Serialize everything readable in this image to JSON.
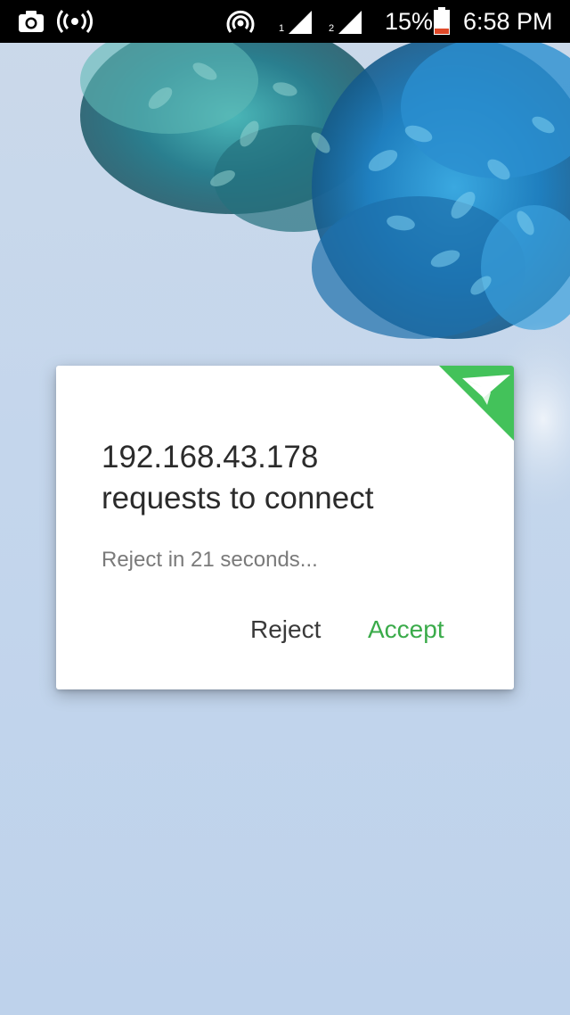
{
  "status_bar": {
    "battery_percent": "15%",
    "time": "6:58 PM",
    "sim1_label": "1",
    "sim2_label": "2",
    "icons": [
      "camera-icon",
      "hotspot-broadcast-icon",
      "wifi-hotspot-icon",
      "signal-sim1-icon",
      "signal-sim2-icon",
      "battery-low-icon"
    ]
  },
  "dialog": {
    "title_line1": "192.168.43.178",
    "title_line2": "requests to connect",
    "countdown": "Reject in 21 seconds...",
    "reject_label": "Reject",
    "accept_label": "Accept",
    "badge_icon": "paper-plane-icon"
  },
  "colors": {
    "accent": "#3aab4a",
    "badge": "#43c25a",
    "battery_low": "#e04a2a",
    "status_bar": "#000000"
  }
}
